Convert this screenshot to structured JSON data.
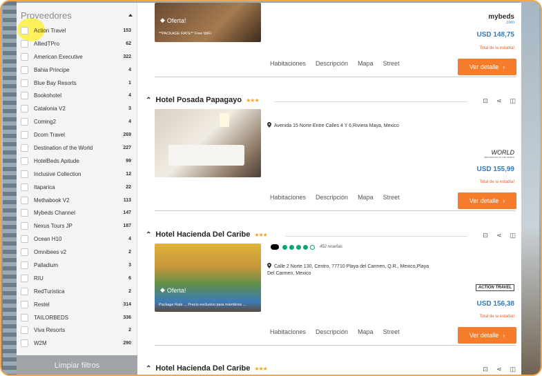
{
  "sidebar": {
    "title": "Proveedores",
    "clear_label": "Limpiar filtros",
    "providers": [
      {
        "label": "Action Travel",
        "count": "153"
      },
      {
        "label": "AlliedTPro",
        "count": "62"
      },
      {
        "label": "American Executive",
        "count": "322"
      },
      {
        "label": "Bahia Principe",
        "count": "4"
      },
      {
        "label": "Blue Bay Resorts",
        "count": "1"
      },
      {
        "label": "Bookohotel",
        "count": "4"
      },
      {
        "label": "Catalonia V2",
        "count": "3"
      },
      {
        "label": "Coming2",
        "count": "4"
      },
      {
        "label": "Dcom Travel",
        "count": "269"
      },
      {
        "label": "Destination of the World",
        "count": "227"
      },
      {
        "label": "HotelBeds Apitude",
        "count": "99"
      },
      {
        "label": "Inclusive Collection",
        "count": "12"
      },
      {
        "label": "Itaparica",
        "count": "22"
      },
      {
        "label": "Methabook V2",
        "count": "113"
      },
      {
        "label": "Mybeds Channel",
        "count": "147"
      },
      {
        "label": "Nexus Tours JP",
        "count": "187"
      },
      {
        "label": "Ocean H10",
        "count": "4"
      },
      {
        "label": "Omnibees v2",
        "count": "2"
      },
      {
        "label": "Palladium",
        "count": "3"
      },
      {
        "label": "RIU",
        "count": "6"
      },
      {
        "label": "RedTuristica",
        "count": "2"
      },
      {
        "label": "Restel",
        "count": "314"
      },
      {
        "label": "TAILORBEDS",
        "count": "336"
      },
      {
        "label": "Viva Resorts",
        "count": "2"
      },
      {
        "label": "W2M",
        "count": "290"
      }
    ]
  },
  "common": {
    "tabs": [
      "Habitaciones",
      "Descripción",
      "Mapa",
      "Street"
    ],
    "detail_label": "Ver detalle",
    "total_label": "Total de la estadía!",
    "offer_label": "Oferta!",
    "stars": "★★★"
  },
  "hotels": [
    {
      "price": "USD 148,75",
      "logo": "mybeds",
      "logo_sub": ".com",
      "package_note": "**PACKAGE RATE** Free WiFi"
    },
    {
      "name": "Hotel Posada Papagayo",
      "address": "Avenida 15 Norte Entre Calles 4 Y 6,Riviera Maya, Mexico",
      "price": "USD 155,99",
      "logo": "WORLD",
      "logo_sub": "DESTINATION OF THE WORLD"
    },
    {
      "name": "Hotel Hacienda Del Caribe",
      "reviews": "452 reseñas",
      "rating_dots": 4,
      "address": "Calle 2 Norte 130, Centro, 77710 Playa del Carmen, Q.R., Mexico,Playa Del Carmen, Mexico",
      "price": "USD 156,38",
      "package_note": "Package Rate ... Precio exclusivo para miembros ...",
      "logo": "ACTION TRAVEL"
    },
    {
      "name": "Hotel Hacienda Del Caribe"
    }
  ],
  "colors": {
    "accent_orange": "#f47c2a",
    "price_blue": "#2f7dc0",
    "star_gold": "#f4a020",
    "tripadvisor_green": "#00aa6c"
  }
}
